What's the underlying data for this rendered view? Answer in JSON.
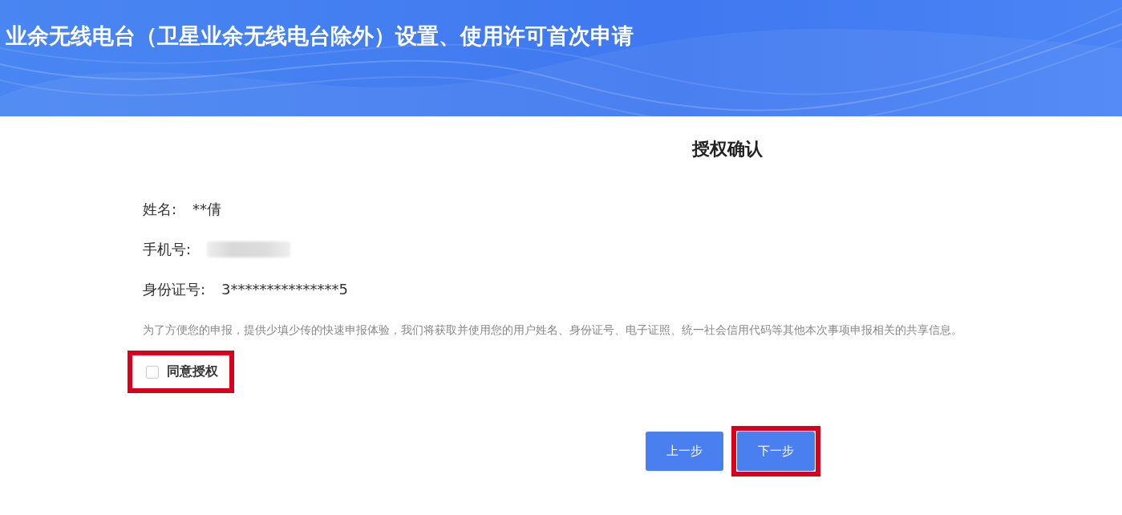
{
  "header": {
    "title": "业余无线电台（卫星业余无线电台除外）设置、使用许可首次申请"
  },
  "form": {
    "heading": "授权确认",
    "fields": [
      {
        "kind": "text",
        "label": "姓名:",
        "value": "**倩"
      },
      {
        "kind": "redacted",
        "label": "手机号:"
      },
      {
        "kind": "text",
        "label": "身份证号:",
        "value": "3***************5"
      }
    ],
    "notice": "为了方便您的申报，提供少填少传的快速申报体验，我们将获取并使用您的用户姓名、身份证号、电子证照、统一社会信用代码等其他本次事项申报相关的共享信息。",
    "consent": {
      "label": "同意授权",
      "checked": false,
      "highlighted": true
    }
  },
  "buttons": [
    {
      "label": "上一步",
      "highlighted": false
    },
    {
      "label": "下一步",
      "highlighted": true
    }
  ]
}
